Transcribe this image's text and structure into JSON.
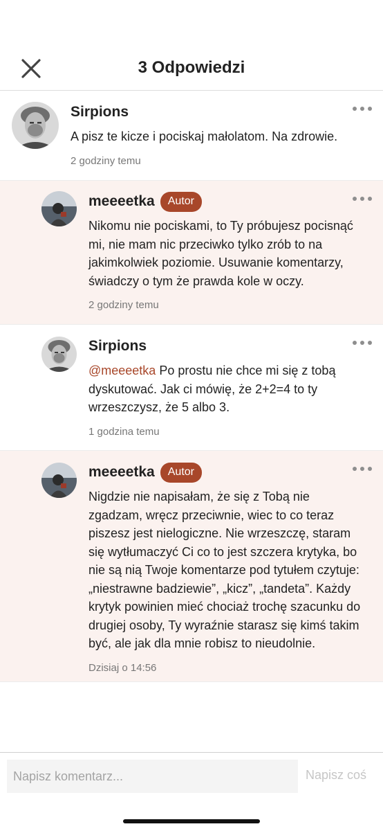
{
  "header": {
    "title": "3 Odpowiedzi",
    "close_icon": "close-icon"
  },
  "comment": {
    "author": "Sirpions",
    "text": "A pisz te kicze i pociskaj małolatom. Na zdrowie.",
    "time": "2 godziny temu"
  },
  "replies": [
    {
      "author": "meeeetka",
      "badge": "Autor",
      "text": "Nikomu nie pociskami, to Ty próbujesz pocisnąć mi, nie mam nic przeciwko tylko zrób to na jakimkolwiek poziomie. Usuwanie komentarzy, świadczy o tym że prawda kole w oczy.",
      "time": "2 godziny temu"
    },
    {
      "author": "Sirpions",
      "mention": "@meeeetka",
      "text": " Po prostu nie chce mi się z tobą dyskutować. Jak ci mówię, że 2+2=4 to ty wrzeszczysz, że 5 albo 3.",
      "time": "1 godzina temu"
    },
    {
      "author": "meeeetka",
      "badge": "Autor",
      "text": "Nigdzie nie napisałam, że się z Tobą nie zgadzam, wręcz przeciwnie, wiec to co teraz piszesz jest nielogiczne. Nie wrzeszczę, staram się wytłumaczyć Ci co to jest szczera krytyka, bo nie są nią Twoje komentarze pod tytułem czytuje: „niestrawne badziewie”, „kicz”, „tandeta”. Każdy krytyk powinien mieć chociaż trochę szacunku do drugiej osoby, Ty wyraźnie starasz się kimś takim być, ale jak dla mnie robisz to nieudolnie.",
      "time": "Dzisiaj o 14:56"
    }
  ],
  "footer": {
    "input_placeholder": "Napisz komentarz...",
    "input_value": "",
    "send_label": "Napisz coś"
  },
  "colors": {
    "accent": "#a8472a",
    "reply_background": "#fbf2ef",
    "muted_text": "#777777",
    "disabled_text": "#c6c6c6"
  }
}
